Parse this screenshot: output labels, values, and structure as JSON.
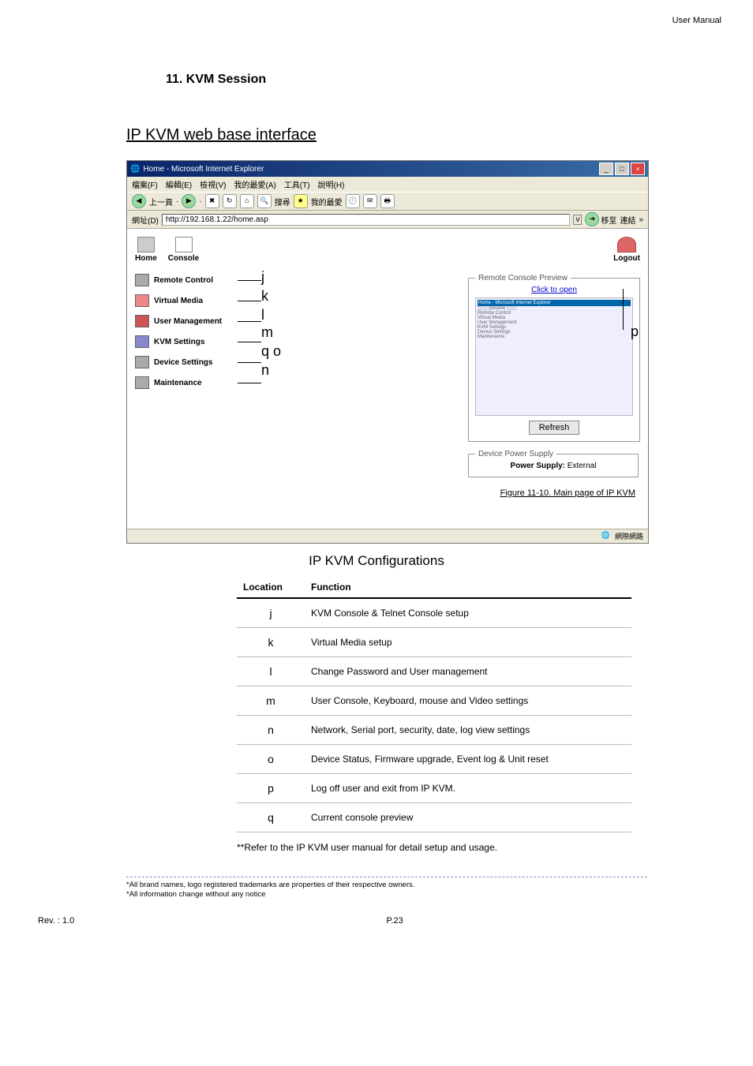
{
  "doc": {
    "header": "User Manual",
    "section_number_title": "11.    KVM Session",
    "subtitle": "IP KVM web base interface",
    "figure_caption": "Figure 11-10. Main page of IP KVM",
    "config_heading": "IP KVM Configurations",
    "footnote": "**Refer to the IP KVM user manual for detail setup and usage.",
    "legal1": "*All brand names, logo registered trademarks are properties of their respective owners.",
    "legal2": "*All information change without any notice",
    "rev": "Rev. : 1.0",
    "page": "P.23"
  },
  "browser": {
    "title": "Home - Microsoft Internet Explorer",
    "menus": {
      "file": "檔案(F)",
      "edit": "編輯(E)",
      "view": "檢視(V)",
      "fav": "我的最愛(A)",
      "tools": "工具(T)",
      "help": "說明(H)"
    },
    "toolbar": {
      "back": "上一頁",
      "search": "搜尋",
      "fav": "我的最愛"
    },
    "address_label": "網址(D)",
    "url": "http://192.168.1.22/home.asp",
    "go": "移至",
    "links": "連結",
    "status_zone": "網際網路"
  },
  "app": {
    "home": "Home",
    "console": "Console",
    "logout": "Logout",
    "nav": {
      "remote": "Remote Control",
      "vmedia": "Virtual Media",
      "usermgmt": "User Management",
      "kvmset": "KVM Settings",
      "devset": "Device Settings",
      "maint": "Maintenance"
    },
    "preview": {
      "legend": "Remote Console Preview",
      "click": "Click to open",
      "refresh": "Refresh"
    },
    "power": {
      "legend": "Device Power Supply",
      "label": "Power Supply:",
      "value": "External"
    }
  },
  "callouts": {
    "j": "j",
    "k": "k",
    "l": "l",
    "m": "m",
    "n": "n",
    "o": "o",
    "p": "p",
    "q": "q"
  },
  "table": {
    "hdr_loc": "Location",
    "hdr_func": "Function",
    "rows": [
      {
        "loc": "j",
        "func": "KVM Console & Telnet Console setup"
      },
      {
        "loc": "k",
        "func": "Virtual Media setup"
      },
      {
        "loc": "l",
        "func": "Change Password  and User management"
      },
      {
        "loc": "m",
        "func": "User Console, Keyboard, mouse and Video settings"
      },
      {
        "loc": "n",
        "func": "Network, Serial port, security, date, log view settings"
      },
      {
        "loc": "o",
        "func": "Device Status, Firmware upgrade, Event log & Unit reset"
      },
      {
        "loc": "p",
        "func": "Log off user and exit from IP KVM."
      },
      {
        "loc": "q",
        "func": "Current console preview"
      }
    ]
  }
}
